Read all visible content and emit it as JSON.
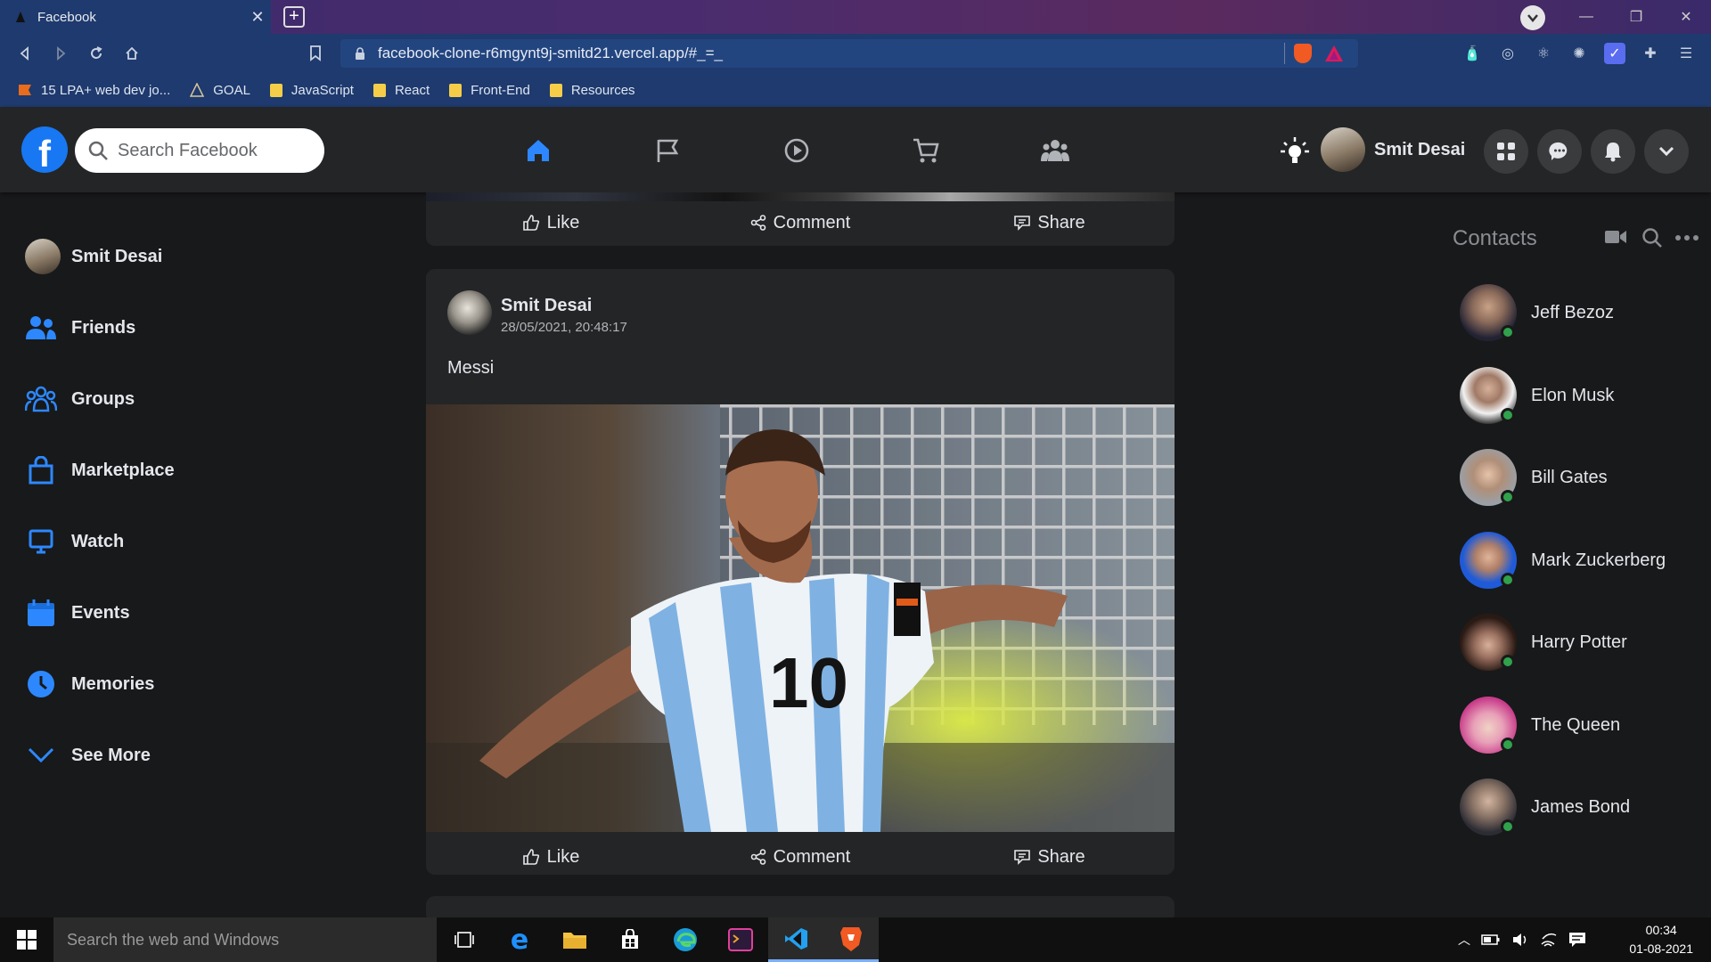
{
  "browser": {
    "tab_title": "Facebook",
    "tab_close": "✕",
    "new_tab": "+",
    "address": "facebook-clone-r6mgynt9j-smitd21.vercel.app/#_=_",
    "bookmarks": [
      {
        "label": "15 LPA+ web dev jo...",
        "icon": "bookmark-flag-icon"
      },
      {
        "label": "GOAL",
        "icon": "goal-icon"
      },
      {
        "label": "JavaScript",
        "icon": "folder-icon"
      },
      {
        "label": "React",
        "icon": "folder-icon"
      },
      {
        "label": "Front-End",
        "icon": "folder-icon"
      },
      {
        "label": "Resources",
        "icon": "folder-icon"
      }
    ]
  },
  "header": {
    "logo": "f",
    "search_placeholder": "Search Facebook",
    "profile_name": "Smit Desai",
    "nav_icons": [
      "home-icon",
      "pages-flag-icon",
      "watch-icon",
      "marketplace-cart-icon",
      "groups-icon"
    ],
    "accent": "#2d88ff"
  },
  "sidebar": {
    "profile_name": "Smit Desai",
    "items": [
      {
        "label": "Friends",
        "icon": "friends-icon"
      },
      {
        "label": "Groups",
        "icon": "groups-icon"
      },
      {
        "label": "Marketplace",
        "icon": "marketplace-icon"
      },
      {
        "label": "Watch",
        "icon": "watch-icon"
      },
      {
        "label": "Events",
        "icon": "events-icon"
      },
      {
        "label": "Memories",
        "icon": "memories-icon"
      },
      {
        "label": "See More",
        "icon": "chevron-down-icon"
      }
    ]
  },
  "feed": {
    "actions": {
      "like": "Like",
      "comment": "Comment",
      "share": "Share"
    },
    "post": {
      "author": "Smit Desai",
      "timestamp": "28/05/2021, 20:48:17",
      "text": "Messi"
    }
  },
  "contacts": {
    "title": "Contacts",
    "list": [
      {
        "name": "Jeff Bezoz",
        "online": true
      },
      {
        "name": "Elon Musk",
        "online": true
      },
      {
        "name": "Bill Gates",
        "online": true
      },
      {
        "name": "Mark Zuckerberg",
        "online": true
      },
      {
        "name": "Harry Potter",
        "online": true
      },
      {
        "name": "The Queen",
        "online": true
      },
      {
        "name": "James Bond",
        "online": true
      }
    ]
  },
  "taskbar": {
    "search_placeholder": "Search the web and Windows",
    "time": "00:34",
    "date": "01-08-2021"
  }
}
